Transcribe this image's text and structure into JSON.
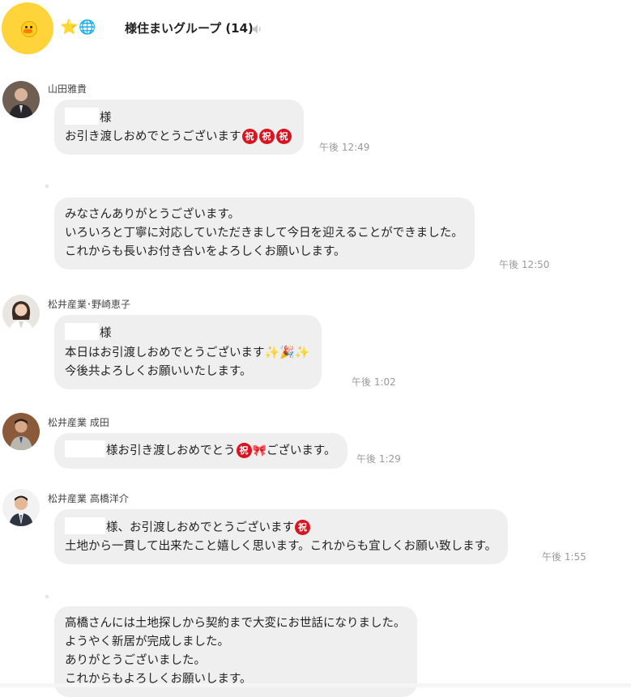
{
  "header": {
    "group_title": "様住まいグループ (14)",
    "icons": [
      "star-icon",
      "globe-icon",
      "mute-icon"
    ],
    "star": "⭐",
    "globe": "🌐"
  },
  "emoji": {
    "iwai": "祝",
    "sparkle": "✨",
    "popper": "🎉",
    "ribbon": "🎀"
  },
  "messages": [
    {
      "sender": "山田雅貴",
      "lines": [
        "様",
        "お引き渡しおめでとうございます"
      ],
      "time": "午後 12:49"
    },
    {
      "sender": "",
      "lines": [
        "みなさんありがとうございます。",
        "いろいろと丁寧に対応していただきまして今日を迎えることができました。",
        "これからも長いお付き合いをよろしくお願いします。"
      ],
      "time": "午後 12:50"
    },
    {
      "sender": "松井産業･野崎恵子",
      "lines": [
        "様",
        "本日はお引渡しおめでとうございます",
        "今後共よろしくお願いいたします。"
      ],
      "time": "午後 1:02"
    },
    {
      "sender": "松井産業 成田",
      "lines": [
        "様お引き渡しおめでとう",
        "ございます。"
      ],
      "time": "午後 1:29"
    },
    {
      "sender": "松井産業 高橋洋介",
      "lines": [
        "様、お引渡しおめでとうございます",
        "土地から一貫して出来たこと嬉しく思います。これからも宜しくお願い致します。"
      ],
      "time": "午後 1:55"
    },
    {
      "sender": "",
      "lines": [
        "高橋さんには土地探しから契約まで大変にお世話になりました。",
        "ようやく新居が完成しました。",
        "ありがとうございました。",
        "これからもよろしくお願いします。"
      ],
      "time": ""
    }
  ],
  "colors": {
    "bubble": "#efefef",
    "group_avatar": "#ffd43b",
    "iwai_badge": "#d9131f",
    "timestamp": "#9a9a9a"
  }
}
